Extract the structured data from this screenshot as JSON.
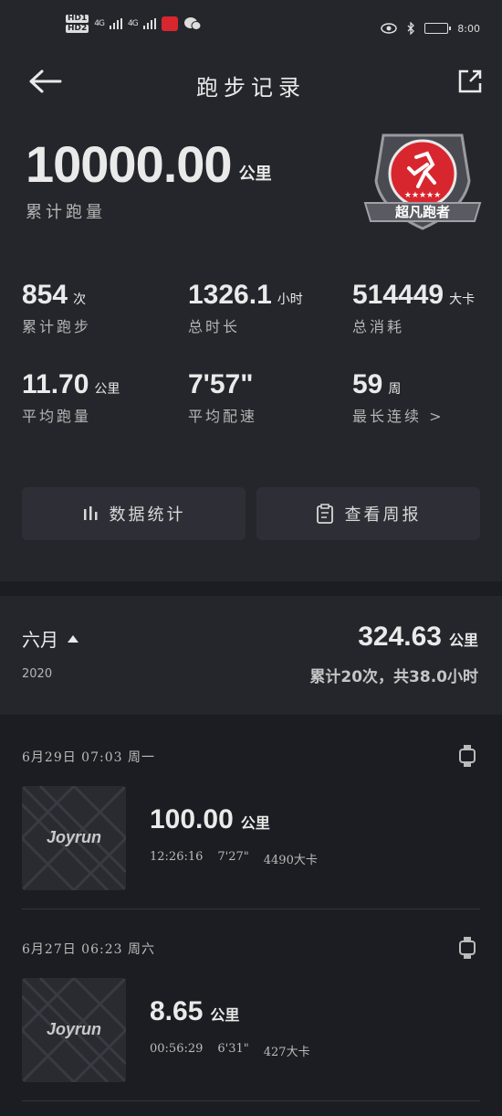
{
  "status": {
    "hd1": "HD1",
    "hd2": "HD2",
    "signal1": "4G",
    "signal2": "4G",
    "time": "8:00"
  },
  "nav": {
    "title": "跑步记录"
  },
  "total": {
    "value": "10000.00",
    "unit": "公里",
    "label": "累计跑量"
  },
  "badge": {
    "label": "超凡跑者",
    "color": "#d8262f"
  },
  "stats": [
    {
      "value": "854",
      "unit": "次",
      "label": "累计跑步"
    },
    {
      "value": "1326.1",
      "unit": "小时",
      "label": "总时长"
    },
    {
      "value": "514449",
      "unit": "大卡",
      "label": "总消耗"
    },
    {
      "value": "11.70",
      "unit": "公里",
      "label": "平均跑量"
    },
    {
      "value": "7'57\"",
      "unit": "",
      "label": "平均配速"
    },
    {
      "value": "59",
      "unit": "周",
      "label": "最长连续 >"
    }
  ],
  "actions": {
    "stats_label": "数据统计",
    "weekly_label": "查看周报"
  },
  "month": {
    "title": "六月",
    "year": "2020",
    "distance": "324.63",
    "unit": "公里",
    "summary": "累计20次，共38.0小时"
  },
  "records": [
    {
      "date": "6月29日  07:03  周一",
      "thumb_text": "Joyrun",
      "distance": "100.00",
      "unit": "公里",
      "duration": "12:26:16",
      "pace": "7'27\"",
      "calories": "4490大卡"
    },
    {
      "date": "6月27日  06:23  周六",
      "thumb_text": "Joyrun",
      "distance": "8.65",
      "unit": "公里",
      "duration": "00:56:29",
      "pace": "6'31\"",
      "calories": "427大卡"
    }
  ]
}
